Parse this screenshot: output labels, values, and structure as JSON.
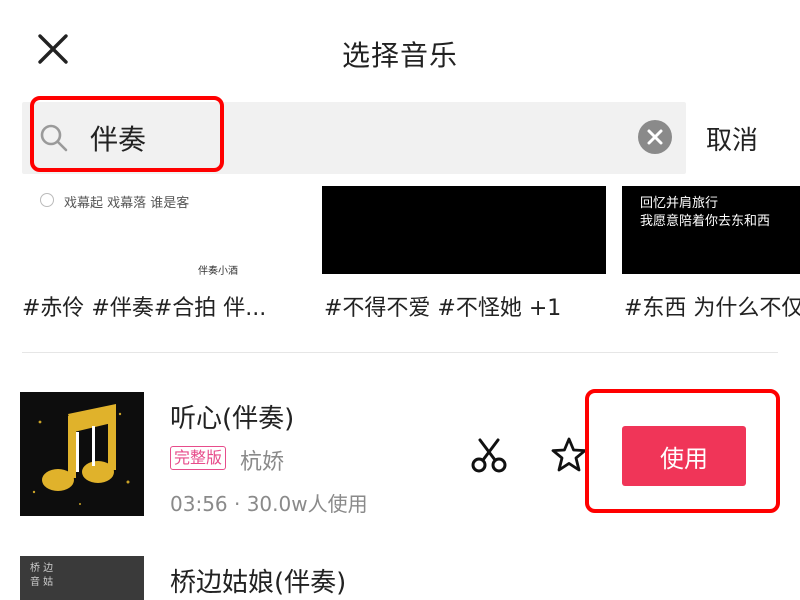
{
  "header": {
    "title": "选择音乐"
  },
  "search": {
    "value": "伴奏",
    "cancel_label": "取消"
  },
  "video_cards": [
    {
      "caption": "戏幕起 戏幕落 谁是客",
      "mark": "伴奏小酒",
      "tags": "#赤伶 #伴奏#合拍 伴..."
    },
    {
      "tags": "#不得不爱 #不怪她 +1"
    },
    {
      "lines": [
        "回忆并肩旅行",
        "我愿意陪着你去东和西"
      ],
      "tags": "#东西 为什么不仅"
    }
  ],
  "songs": [
    {
      "title": "听心(伴奏)",
      "badge": "完整版",
      "artist": "杭娇",
      "meta": "03:56 · 30.0w人使用",
      "use_label": "使用"
    },
    {
      "title": "桥边姑娘(伴奏)",
      "cover_text": "桥 边 音 姑"
    }
  ],
  "colors": {
    "accent": "#f03558",
    "highlight": "#ff0000",
    "badge": "#e74c8b"
  },
  "icons": {
    "close": "close-icon",
    "search": "search-icon",
    "clear": "clear-icon",
    "scissors": "scissors-icon",
    "star": "star-icon"
  }
}
